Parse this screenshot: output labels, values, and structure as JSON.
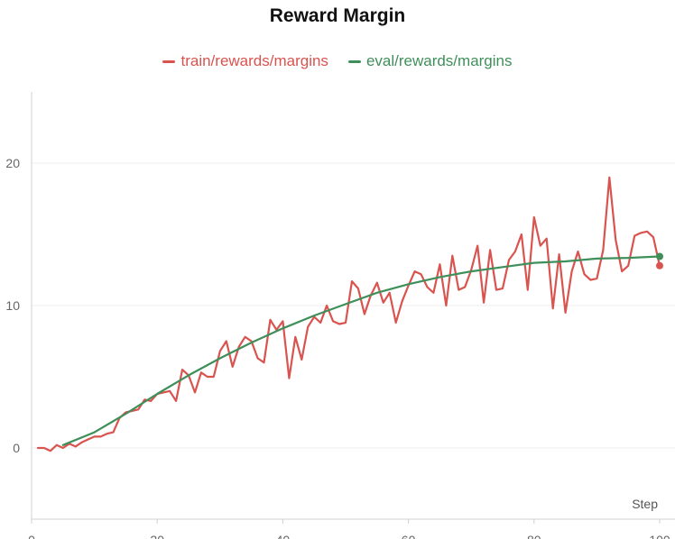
{
  "chart_data": {
    "type": "line",
    "title": "Reward Margin",
    "xlabel": "Step",
    "ylabel": "",
    "xlim": [
      0,
      100
    ],
    "ylim": [
      -5,
      25
    ],
    "x_ticks": [
      0,
      20,
      40,
      60,
      80,
      100
    ],
    "y_ticks": [
      0,
      10,
      20
    ],
    "grid": true,
    "legend_position": "top-center",
    "series": [
      {
        "name": "train/rewards/margins",
        "color": "#d9534f",
        "x": [
          1,
          2,
          3,
          4,
          5,
          6,
          7,
          8,
          9,
          10,
          11,
          12,
          13,
          14,
          15,
          16,
          17,
          18,
          19,
          20,
          21,
          22,
          23,
          24,
          25,
          26,
          27,
          28,
          29,
          30,
          31,
          32,
          33,
          34,
          35,
          36,
          37,
          38,
          39,
          40,
          41,
          42,
          43,
          44,
          45,
          46,
          47,
          48,
          49,
          50,
          51,
          52,
          53,
          54,
          55,
          56,
          57,
          58,
          59,
          60,
          61,
          62,
          63,
          64,
          65,
          66,
          67,
          68,
          69,
          70,
          71,
          72,
          73,
          74,
          75,
          76,
          77,
          78,
          79,
          80,
          81,
          82,
          83,
          84,
          85,
          86,
          87,
          88,
          89,
          90,
          91,
          92,
          93,
          94,
          95,
          96,
          97,
          98,
          99,
          100
        ],
        "y": [
          0.0,
          0.0,
          -0.2,
          0.2,
          0.0,
          0.3,
          0.1,
          0.4,
          0.6,
          0.8,
          0.8,
          1.0,
          1.1,
          2.1,
          2.5,
          2.6,
          2.7,
          3.4,
          3.3,
          3.8,
          3.9,
          4.0,
          3.3,
          5.5,
          5.1,
          3.9,
          5.3,
          5.0,
          5.0,
          6.8,
          7.5,
          5.7,
          7.1,
          7.8,
          7.5,
          6.3,
          6.0,
          9.0,
          8.3,
          8.9,
          4.9,
          7.8,
          6.2,
          8.5,
          9.2,
          8.8,
          10.0,
          8.9,
          8.7,
          8.8,
          11.7,
          11.2,
          9.4,
          10.7,
          11.6,
          10.2,
          10.9,
          8.8,
          10.3,
          11.4,
          12.4,
          12.2,
          11.3,
          10.9,
          12.9,
          10.0,
          13.5,
          11.1,
          11.3,
          12.5,
          14.2,
          10.2,
          13.9,
          11.1,
          11.2,
          13.2,
          13.8,
          15.0,
          11.1,
          16.2,
          14.2,
          14.7,
          9.8,
          13.6,
          9.5,
          12.4,
          13.8,
          12.2,
          11.8,
          11.9,
          13.9,
          19.0,
          14.6,
          12.4,
          12.8,
          14.9,
          15.1,
          15.2,
          14.8,
          12.8
        ]
      },
      {
        "name": "eval/rewards/margins",
        "color": "#3f8f5a",
        "x": [
          5,
          10,
          15,
          20,
          25,
          30,
          35,
          40,
          45,
          50,
          55,
          60,
          65,
          70,
          75,
          80,
          85,
          90,
          95,
          100
        ],
        "y": [
          0.2,
          1.1,
          2.4,
          3.8,
          5.1,
          6.3,
          7.4,
          8.4,
          9.3,
          10.1,
          10.9,
          11.5,
          12.0,
          12.4,
          12.7,
          13.0,
          13.1,
          13.3,
          13.35,
          13.45
        ]
      }
    ]
  }
}
